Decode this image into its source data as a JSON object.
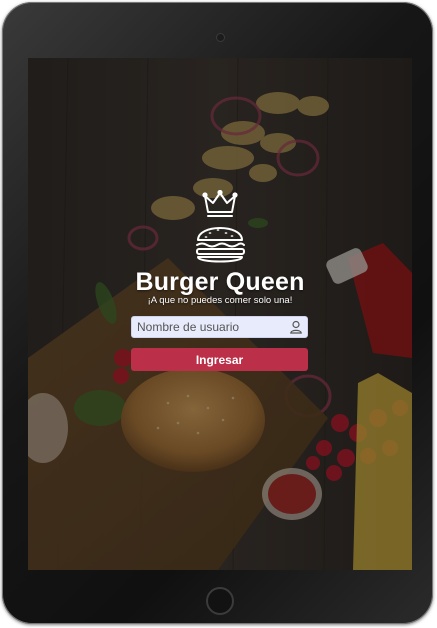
{
  "brand": {
    "title": "Burger Queen",
    "tagline": "¡A que no puedes comer solo una!"
  },
  "login": {
    "username_placeholder": "Nombre de usuario",
    "username_value": "",
    "submit_label": "Ingresar"
  },
  "icons": {
    "logo": "burger-crown-icon",
    "user": "user-icon"
  },
  "colors": {
    "accent": "#bb2f48",
    "input_bg": "#e8ebfb",
    "text_on_dark": "#ffffff"
  }
}
